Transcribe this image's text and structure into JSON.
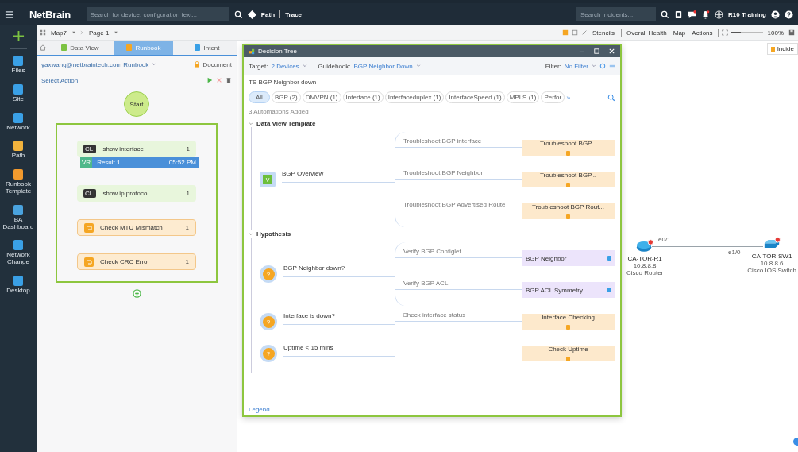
{
  "topbar": {
    "logo": "NetBrain",
    "search": {
      "placeholder": "Search for device, configuration text..."
    },
    "path_label": "Path",
    "trace_label": "Trace",
    "incident_search": {
      "placeholder": "Search Incidents..."
    },
    "domain": "R10 Training"
  },
  "sidebar": {
    "items": [
      {
        "label": "Files"
      },
      {
        "label": "Site"
      },
      {
        "label": "Network"
      },
      {
        "label": "Path"
      },
      {
        "label": "Runbook Template"
      },
      {
        "label": "BA Dashboard"
      },
      {
        "label": "Network Change"
      },
      {
        "label": "Desktop"
      }
    ]
  },
  "toolbar": {
    "map": "Map7",
    "page": "Page 1",
    "actions": [
      "Stencils",
      "Overall Health",
      "Map",
      "Actions"
    ],
    "zoom_slider": {
      "level": 0.3
    },
    "zoom": "100%"
  },
  "runbook_panel": {
    "tabs": [
      {
        "label": "Data View",
        "selected": false
      },
      {
        "label": "Runbook",
        "selected": true
      },
      {
        "label": "Intent",
        "selected": false
      }
    ],
    "owner": "yaxwang@netbraintech.com Runbook",
    "document": "Document",
    "select_action": "Select Action",
    "start": "Start",
    "steps": [
      {
        "kind": "cli",
        "badge": "CLI",
        "label": "show interface",
        "count": "1",
        "result": {
          "badge": "VR",
          "label": "Result 1",
          "time": "05:52 PM"
        }
      },
      {
        "kind": "cli",
        "badge": "CLI",
        "label": "show ip protocol",
        "count": "1"
      },
      {
        "kind": "check",
        "label": "Check MTU Mismatch",
        "count": "1"
      },
      {
        "kind": "check",
        "label": "Check CRC Error",
        "count": "1"
      }
    ]
  },
  "decision_tree": {
    "title": "Decision Tree",
    "target_label": "Target:",
    "target": "2 Devices",
    "guidebook_label": "Guidebook:",
    "guidebook": "BGP Neighbor Down",
    "filter_label": "Filter:",
    "filter": "No Filter",
    "heading": "TS BGP Neighbor down",
    "chips": [
      {
        "label": "All",
        "selected": true
      },
      {
        "label": "BGP (2)",
        "selected": false
      },
      {
        "label": "DMVPN (1)",
        "selected": false
      },
      {
        "label": "Interface (1)",
        "selected": false
      },
      {
        "label": "Interfaceduplex (1)",
        "selected": false
      },
      {
        "label": "InterfaceSpeed (1)",
        "selected": false
      },
      {
        "label": "MPLS (1)",
        "selected": false
      },
      {
        "label": "Perfor",
        "selected": false
      }
    ],
    "more": "»",
    "automations": "3 Automations Added",
    "sections": [
      {
        "title": "Data View Template",
        "nodes": [
          {
            "kind": "dataview",
            "badge": "V",
            "label": "BGP Overview",
            "branches": [
              {
                "label": "Troubleshoot BGP interface",
                "result": "Troubleshoot BGP...",
                "kind": "runbook"
              },
              {
                "label": "Troubleshoot BGP Neighbor",
                "result": "Troubleshoot BGP...",
                "kind": "runbook"
              },
              {
                "label": "Troubleshoot BGP Advertised Route",
                "result": "Troubleshoot BGP Rout...",
                "kind": "runbook"
              }
            ]
          }
        ]
      },
      {
        "title": "Hypothesis",
        "nodes": [
          {
            "kind": "question",
            "badge": "?",
            "label": "BGP Neighbor down?",
            "branches": [
              {
                "label": "Verify BGP Configlet",
                "result": "BGP Neighbor",
                "kind": "intent"
              },
              {
                "label": "Verify BGP ACL",
                "result": "BGP ACL Symmetry",
                "kind": "intent"
              }
            ]
          },
          {
            "kind": "question",
            "badge": "?",
            "label": "Interface is down?",
            "branches": [
              {
                "label": "Check interface status",
                "result": "Interface Checking",
                "kind": "runbook"
              }
            ]
          },
          {
            "kind": "question",
            "badge": "?",
            "label": "Uptime < 15 mins",
            "branches": [
              {
                "result": "Check Uptime",
                "kind": "runbook"
              }
            ]
          }
        ]
      }
    ],
    "legend": "Legend"
  },
  "map": {
    "devices": [
      {
        "name": "CA-TOR-R1",
        "ip": "10.8.8.8",
        "type": "Cisco Router",
        "kind": "router"
      },
      {
        "name": "CA-TOR-SW1",
        "ip": "10.8.8.6",
        "type": "Cisco IOS Switch",
        "kind": "switch"
      }
    ],
    "link": {
      "from_port": "e0/1",
      "to_port": "e1/0"
    },
    "incident_tab": "Incide"
  }
}
